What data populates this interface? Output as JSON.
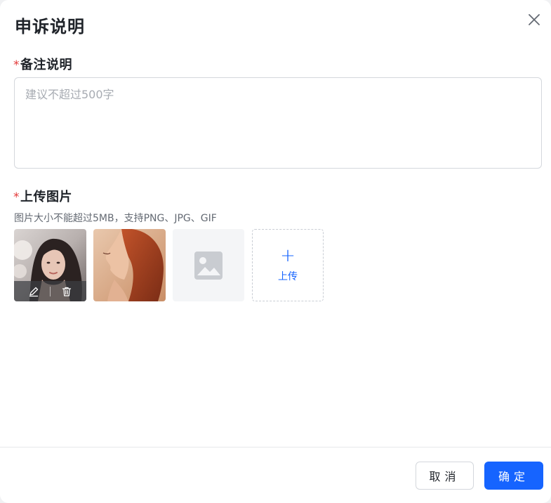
{
  "dialog": {
    "title": "申诉说明"
  },
  "remark": {
    "required_mark": "*",
    "label": "备注说明",
    "value": "",
    "placeholder": "建议不超过500字"
  },
  "upload": {
    "required_mark": "*",
    "label": "上传图片",
    "hint": "图片大小不能超过5MB，支持PNG、JPG、GIF",
    "images": [
      {
        "name": "portrait-dark-hair-woman",
        "icons": [
          "edit-icon",
          "delete-icon"
        ]
      },
      {
        "name": "profile-red-hair-woman"
      },
      {
        "name": "image-placeholder"
      }
    ],
    "add_plus": "+",
    "add_label": "上传"
  },
  "footer": {
    "cancel_label": "取消",
    "confirm_label": "确定"
  },
  "colors": {
    "primary": "#1664ff",
    "required": "#e33a3a",
    "text": "#1f2329",
    "muted": "#646a73"
  }
}
